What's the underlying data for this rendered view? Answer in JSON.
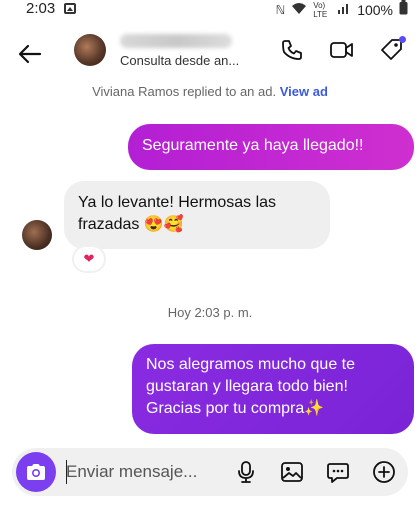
{
  "status_bar": {
    "time": "2:03",
    "battery": "100%",
    "network": "Vo) LTE"
  },
  "header": {
    "subtitle": "Consulta desde an..."
  },
  "reply_note": {
    "text": "Viviana Ramos replied to an ad.",
    "link": "View ad"
  },
  "messages": {
    "m1": "Seguramente ya haya llegado!!",
    "m2_line1": "Ya lo levante! Hermosas las",
    "m2_line2": "frazadas 😍🥰",
    "m2_reaction": "❤",
    "timestamp": "Hoy 2:03 p. m.",
    "m3_line1": "Nos alegramos mucho que te",
    "m3_line2": "gustaran y llegara todo bien!",
    "m3_line3": "Gracias por tu compra✨"
  },
  "composer": {
    "placeholder": "Enviar mensaje..."
  },
  "colors": {
    "outgoing_magenta": "#c026d3",
    "outgoing_purple": "#8a2be2",
    "incoming_bg": "#efefef",
    "camera_bg": "#7b3ff0",
    "link": "#3b5bdb"
  }
}
